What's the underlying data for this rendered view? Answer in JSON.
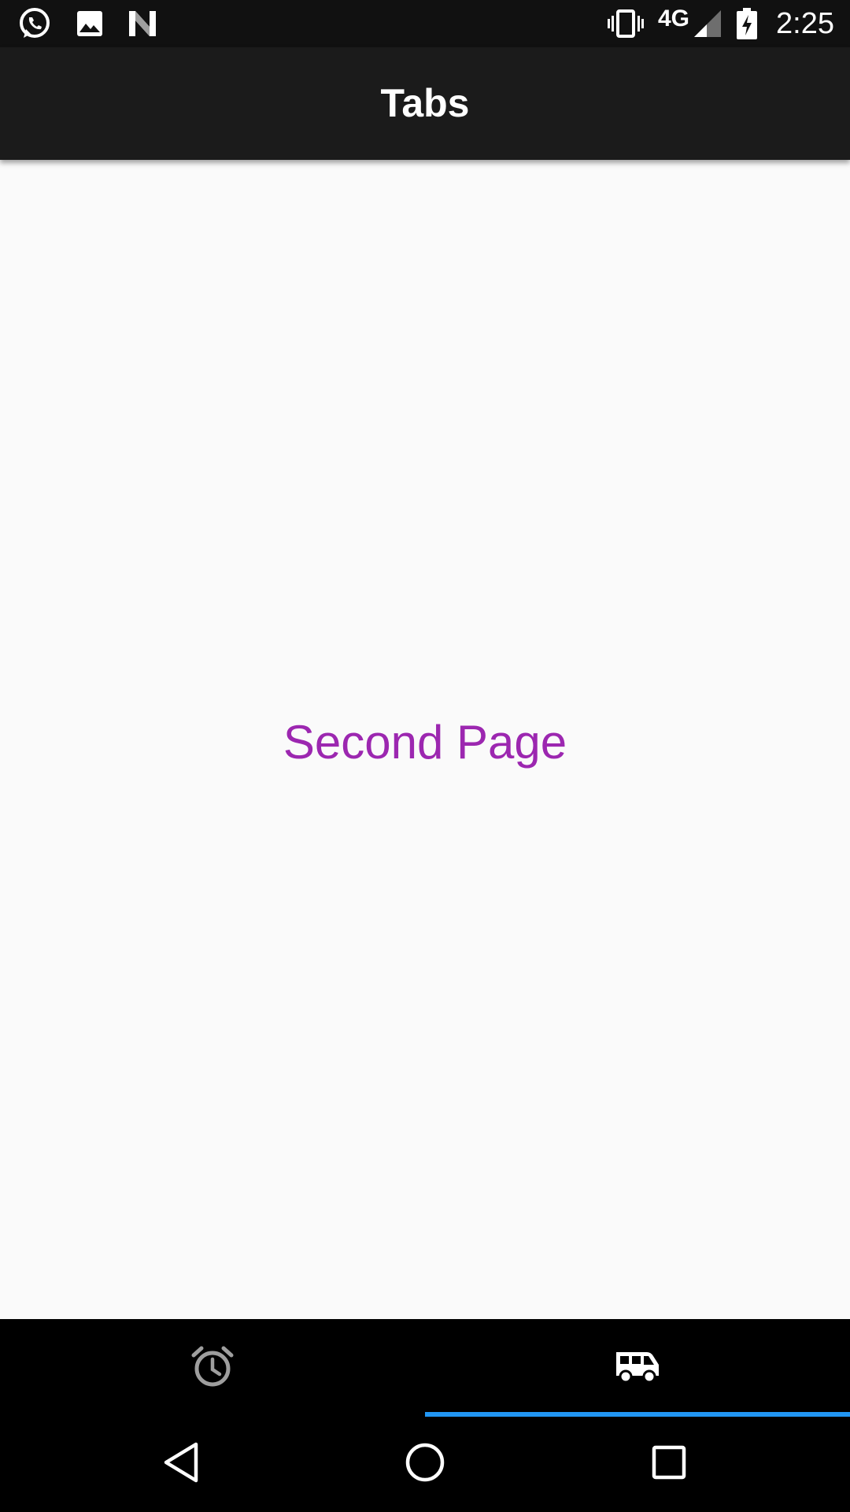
{
  "status_bar": {
    "network": "4G",
    "time": "2:25",
    "notification_icons": [
      "whatsapp-icon",
      "image-icon",
      "n-icon"
    ],
    "system_icons": [
      "vibrate-icon",
      "signal-icon",
      "battery-charging-icon"
    ]
  },
  "app_bar": {
    "title": "Tabs"
  },
  "main": {
    "page_text": "Second Page",
    "page_text_color": "#9c27b0"
  },
  "tabs": [
    {
      "icon": "alarm-clock-icon",
      "selected": false
    },
    {
      "icon": "shuttle-van-icon",
      "selected": true
    }
  ],
  "tab_indicator_color": "#2196f3",
  "nav_bar": {
    "buttons": [
      "back-icon",
      "home-icon",
      "recents-icon"
    ]
  }
}
